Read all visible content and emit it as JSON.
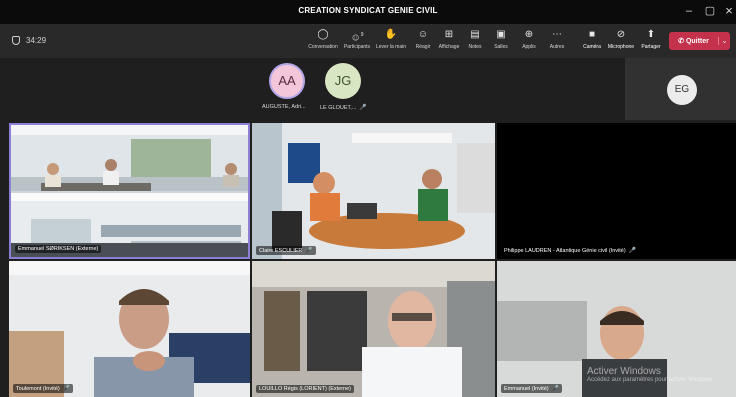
{
  "window": {
    "title": "CREATION SYNDICAT GENIE CIVIL",
    "min": "–",
    "max": "▢",
    "close": "×"
  },
  "toolbar": {
    "timer": "34:29",
    "tools": [
      {
        "label": "Conversation",
        "icon": "chat-icon"
      },
      {
        "label": "Participants",
        "icon": "people-icon",
        "count": "9"
      },
      {
        "label": "Lever la main",
        "icon": "hand-icon"
      },
      {
        "label": "Réagir",
        "icon": "smile-icon"
      },
      {
        "label": "Affichage",
        "icon": "grid-icon"
      },
      {
        "label": "Notes",
        "icon": "notes-icon"
      },
      {
        "label": "Salles",
        "icon": "rooms-icon"
      },
      {
        "label": "Applis",
        "icon": "apps-icon"
      },
      {
        "label": "Autres",
        "icon": "more-icon"
      }
    ],
    "devices": [
      {
        "label": "Caméra",
        "icon": "camera-icon"
      },
      {
        "label": "Microphone",
        "icon": "mic-off-icon"
      },
      {
        "label": "Partager",
        "icon": "share-icon"
      }
    ],
    "quit_label": "Quitter"
  },
  "strip": {
    "participants": [
      {
        "initials": "AA",
        "name": "AUGUSTE, Adri..."
      },
      {
        "initials": "JG",
        "name": "LE GLOUET,..."
      }
    ],
    "overflow_initials": "EG"
  },
  "tiles": [
    {
      "name": "Emmanuel SØRIKSEN (Externe)",
      "scene": "office-room"
    },
    {
      "name": "Claire ESCULIER",
      "scene": "meeting-room"
    },
    {
      "name": "Philippe LAUDREN - Atlantique Génie civil (Invité)",
      "scene": "black"
    },
    {
      "name": "Toulemont (Invité)",
      "scene": "man-chin"
    },
    {
      "name": "LOUILLO Régis (LORIENT) (Externe)",
      "scene": "man-glasses"
    },
    {
      "name": "Emmanuel (Invité)",
      "scene": "man-young"
    }
  ],
  "watermark": {
    "line1": "Activer Windows",
    "line2": "Accédez aux paramètres pour activer Windows."
  },
  "colors": {
    "active_border": "#8b7fd6",
    "quit": "#c4314b",
    "accent": "#6264a7"
  }
}
